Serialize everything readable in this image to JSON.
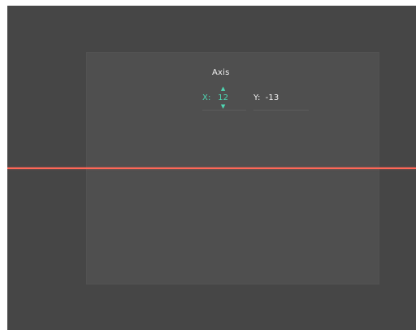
{
  "panel": {
    "title": "Axis",
    "x": {
      "label": "X:",
      "value": "12"
    },
    "y": {
      "label": "Y:",
      "value": "-13"
    }
  },
  "icons": {
    "up": "triangle-up-icon",
    "down": "triangle-down-icon"
  },
  "colors": {
    "background": "#464646",
    "panel": "#4f4f4f",
    "accent": "#4fd7b3",
    "text": "#f1f1f1",
    "line": "#ff6757"
  }
}
